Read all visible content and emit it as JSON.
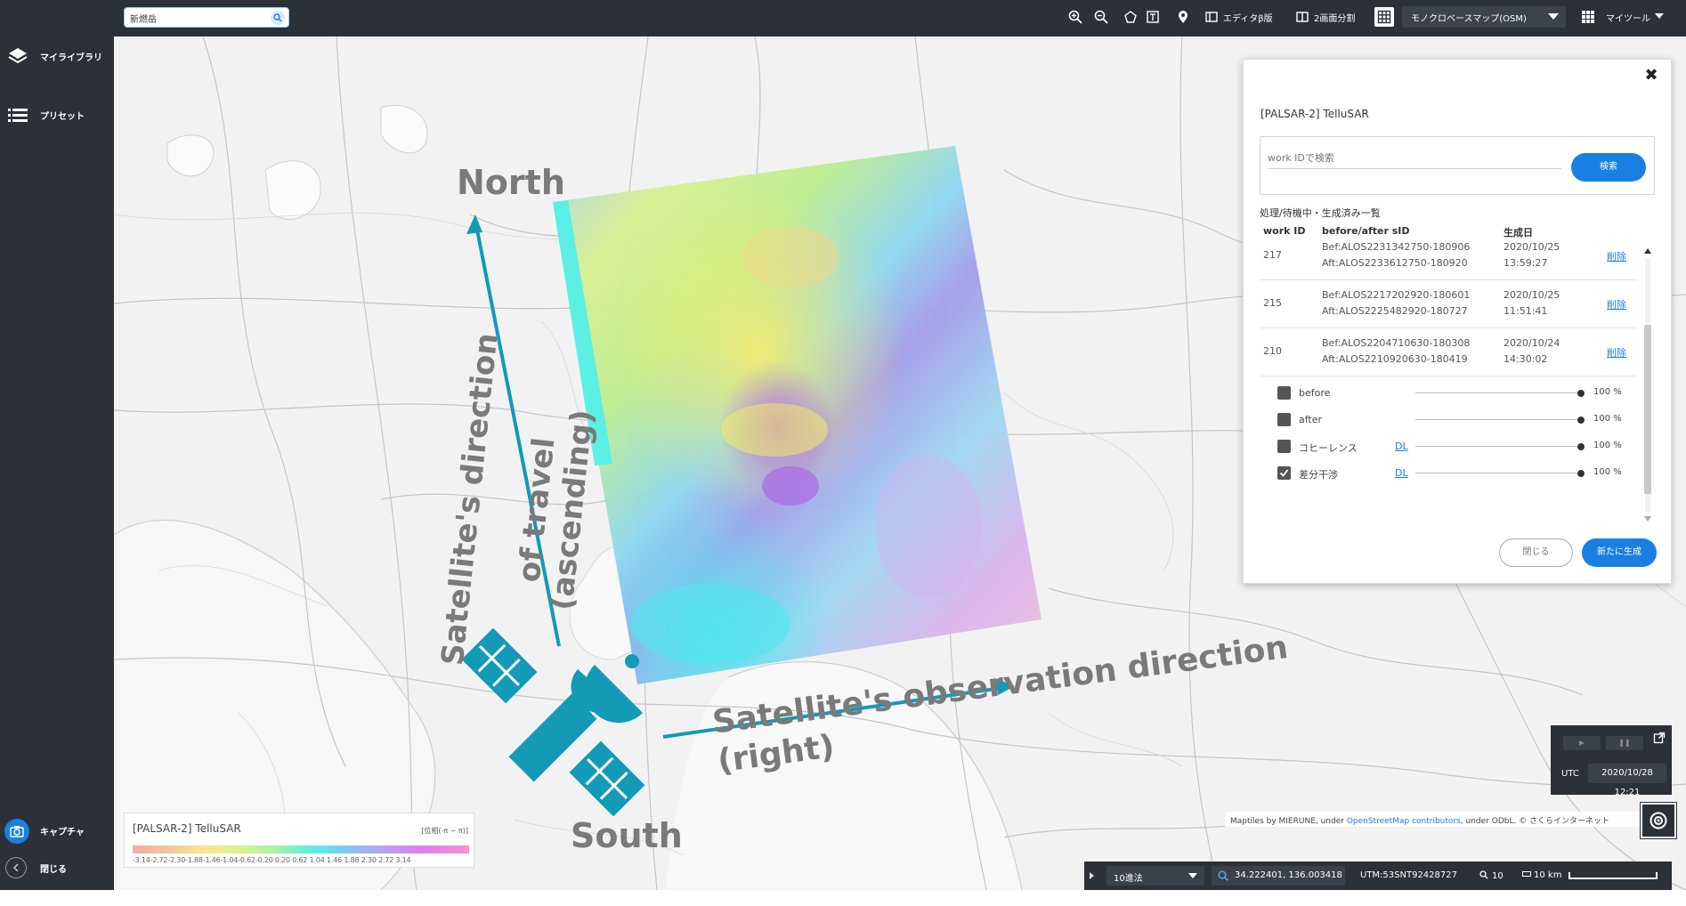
{
  "topbar": {
    "search_value": "新燃岳",
    "editor_label": "エディタβ版",
    "split_label": "2画面分割",
    "basemap_label": "モノクロベースマップ(OSM)",
    "mytool_label": "マイツール"
  },
  "sidebar": {
    "items": [
      {
        "label": "マイライブラリ",
        "icon": "layers-icon"
      },
      {
        "label": "プリセット",
        "icon": "list-icon"
      }
    ],
    "capture_label": "キャプチャ",
    "close_label": "閉じる"
  },
  "panel": {
    "title": "[PALSAR-2] TelluSAR",
    "search_placeholder": "work IDで検索",
    "search_button": "検索",
    "list_heading": "処理/待機中・生成済み一覧",
    "columns": [
      "work ID",
      "before/after sID",
      "生成日"
    ],
    "rows": [
      {
        "id": "217",
        "before": "Bef:ALOS2231342750-180906",
        "after": "Aft:ALOS2233612750-180920",
        "date": "2020/10/25",
        "time": "13:59:27",
        "action": "削除"
      },
      {
        "id": "215",
        "before": "Bef:ALOS2217202920-180601",
        "after": "Aft:ALOS2225482920-180727",
        "date": "2020/10/25",
        "time": "11:51:41",
        "action": "削除"
      },
      {
        "id": "210",
        "before": "Bef:ALOS2204710630-180308",
        "after": "Aft:ALOS2210920630-180419",
        "date": "2020/10/24",
        "time": "14:30:02",
        "action": "削除"
      }
    ],
    "layers": [
      {
        "name": "before",
        "dl": "",
        "opacity": "100 %",
        "checked": false
      },
      {
        "name": "after",
        "dl": "",
        "opacity": "100 %",
        "checked": false
      },
      {
        "name": "コヒーレンス",
        "dl": "DL",
        "opacity": "100 %",
        "checked": false
      },
      {
        "name": "差分干渉",
        "dl": "DL",
        "opacity": "100 %",
        "checked": true
      }
    ],
    "close_button": "閉じる",
    "generate_button": "新たに生成"
  },
  "legend": {
    "title": "[PALSAR-2] TelluSAR",
    "unit": "[位相(-π ~ π)]",
    "ticks": "-3.14-2.72-2.30-1.88-1.46-1.04-0.62-0.20 0.20 0.62 1.04 1.46 1.88 2.30 2.72 3.14"
  },
  "attribution": {
    "prefix": "Maptiles by MIERUNE, under ",
    "link": "OpenStreetMap contributors",
    "suffix": ", under ODbL. © さくらインターネット"
  },
  "time": {
    "tz": "UTC",
    "datetime": "2020/10/28 12:21"
  },
  "status": {
    "format": "10進法",
    "coords": "34.222401, 136.003418",
    "utm": "UTM:53SNT92428727",
    "zoom": "10",
    "scale": "10 km"
  },
  "annotations": {
    "north": "North",
    "south": "South",
    "travel_line1": "Satellite's direction",
    "travel_line2": "of travel",
    "travel_line3": "(ascending)",
    "obs_line1": "Satellite's observation direction",
    "obs_line2": "(right)"
  },
  "colors": {
    "ui_dark": "#2c3137",
    "accent_blue": "#1a7fe2",
    "arrow_teal": "#129ab7",
    "annotation_gray": "#7a7a7a"
  }
}
